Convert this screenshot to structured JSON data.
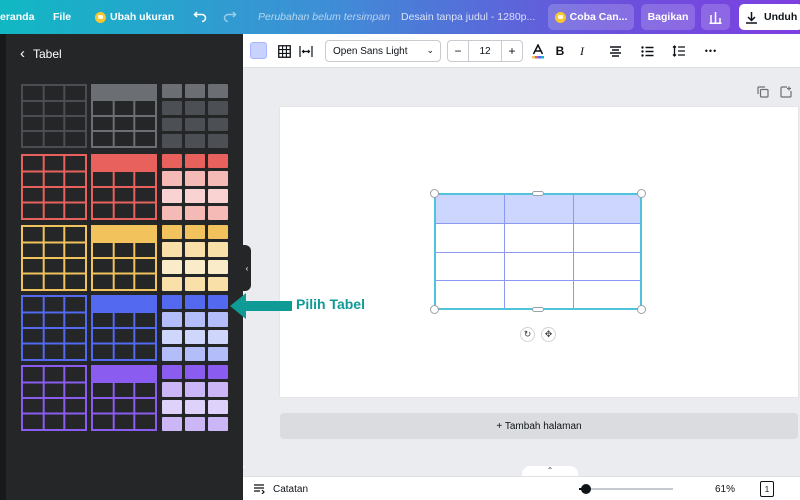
{
  "topbar": {
    "home_label": "eranda",
    "file_label": "File",
    "resize_label": "Ubah ukuran",
    "unsaved_label": "Perubahan belum tersimpan",
    "doc_title": "Desain tanpa judul - 1280p...",
    "try_label": "Coba Can...",
    "share_label": "Bagikan",
    "download_label": "Unduh",
    "colors": {
      "gradient_start": "#11b8c4",
      "gradient_end": "#7d3fe0"
    }
  },
  "sidebar": {
    "title": "Tabel",
    "back_icon": "chevron-left-icon",
    "table_colors": [
      "#4a4d52",
      "#e8615c",
      "#f2c25c",
      "#5269f0",
      "#8a5cf0"
    ],
    "style_columns": [
      "outline",
      "header",
      "filled-cells"
    ]
  },
  "toolbar": {
    "font_name": "Open Sans Light",
    "font_size": "12",
    "minus": "−",
    "plus": "+",
    "bold": "B",
    "italic": "I",
    "more": "•••"
  },
  "canvas": {
    "header_fill": "#cdd6ff",
    "border_color": "#8d98f2",
    "selection_color": "#4fc3d9"
  },
  "annotation": {
    "label": "Pilih Tabel",
    "color": "#0f9b95"
  },
  "add_page_label": "+ Tambah halaman",
  "bottombar": {
    "notes_label": "Catatan",
    "zoom": "61%",
    "page_count": "1"
  }
}
